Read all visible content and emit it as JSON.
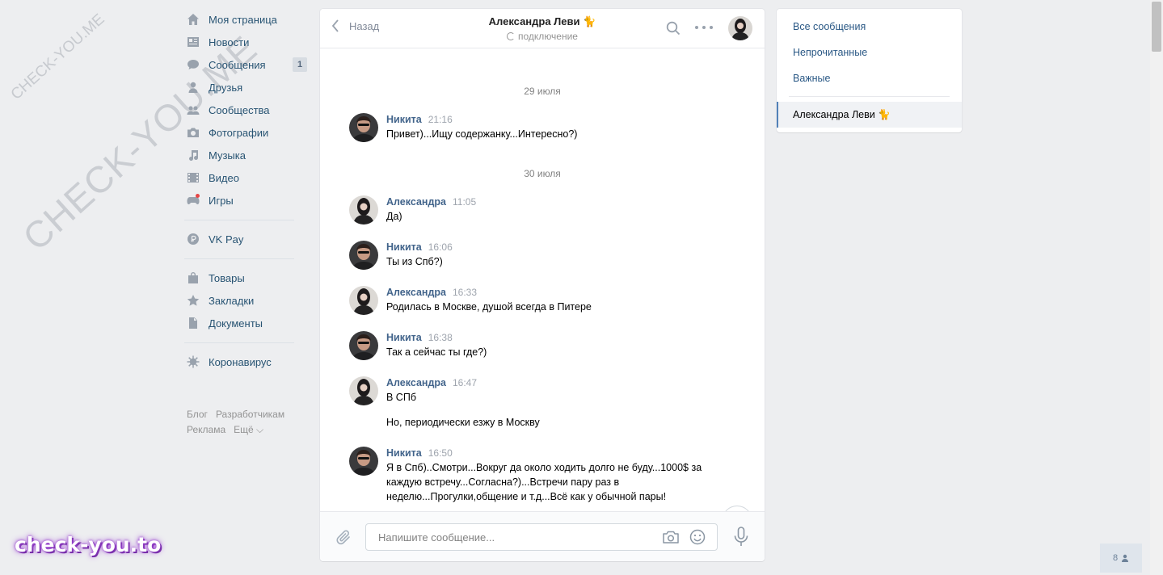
{
  "watermarks": {
    "diagonal_big": "CHECK-YOU.ME",
    "diagonal_small": "CHECK-YOU.ME",
    "brand": "check-you.to"
  },
  "sidebar": {
    "items": [
      {
        "label": "Моя страница",
        "icon": "home-icon"
      },
      {
        "label": "Новости",
        "icon": "news-icon"
      },
      {
        "label": "Сообщения",
        "icon": "messages-icon",
        "badge": "1"
      },
      {
        "label": "Друзья",
        "icon": "friends-icon"
      },
      {
        "label": "Сообщества",
        "icon": "groups-icon"
      },
      {
        "label": "Фотографии",
        "icon": "camera-icon"
      },
      {
        "label": "Музыка",
        "icon": "music-icon"
      },
      {
        "label": "Видео",
        "icon": "video-icon"
      },
      {
        "label": "Игры",
        "icon": "games-icon"
      }
    ],
    "pay": {
      "label": "VK Pay",
      "icon": "vkpay-icon"
    },
    "items2": [
      {
        "label": "Товары",
        "icon": "bag-icon"
      },
      {
        "label": "Закладки",
        "icon": "star-icon"
      },
      {
        "label": "Документы",
        "icon": "document-icon"
      }
    ],
    "corona": {
      "label": "Коронавирус",
      "icon": "virus-icon"
    },
    "footer": {
      "blog": "Блог",
      "developers": "Разработчикам",
      "ads": "Реклама",
      "more": "Ещё ⌵"
    }
  },
  "chat": {
    "back_label": "Назад",
    "title": "Александра Леви",
    "title_emoji": "🐈",
    "status": "подключение",
    "dates": [
      "29 июля",
      "30 июля"
    ],
    "messages": [
      {
        "author": "Никита",
        "time": "21:16",
        "text": "Привет)...Ищу содержанку...Интересно?)"
      },
      {
        "author": "Александра",
        "time": "11:05",
        "text": "Да)"
      },
      {
        "author": "Никита",
        "time": "16:06",
        "text": "Ты из Спб?)"
      },
      {
        "author": "Александра",
        "time": "16:33",
        "text": "Родилась в Москве, душой всегда в Питере"
      },
      {
        "author": "Никита",
        "time": "16:38",
        "text": "Так а сейчас ты где?)"
      },
      {
        "author": "Александра",
        "time": "16:47",
        "text": "В СПб",
        "extra": "Но, периодически езжу в Москву"
      },
      {
        "author": "Никита",
        "time": "16:50",
        "text": "Я в Спб)..Смотри...Вокруг да около ходить долго не буду...1000$ за каждую встречу...Согласна?)...Встречи пару раз в неделю...Прогулки,общение и т.д...Всё как у обычной пары!"
      }
    ],
    "composer": {
      "placeholder": "Напишите сообщение..."
    }
  },
  "filters": {
    "all": "Все сообщения",
    "unread": "Непрочитанные",
    "important": "Важные",
    "active_chat": "Александра Леви 🐈"
  },
  "online_count": "8",
  "colors": {
    "accent": "#5181b8",
    "link": "#2a5885",
    "background": "#edeef0"
  }
}
